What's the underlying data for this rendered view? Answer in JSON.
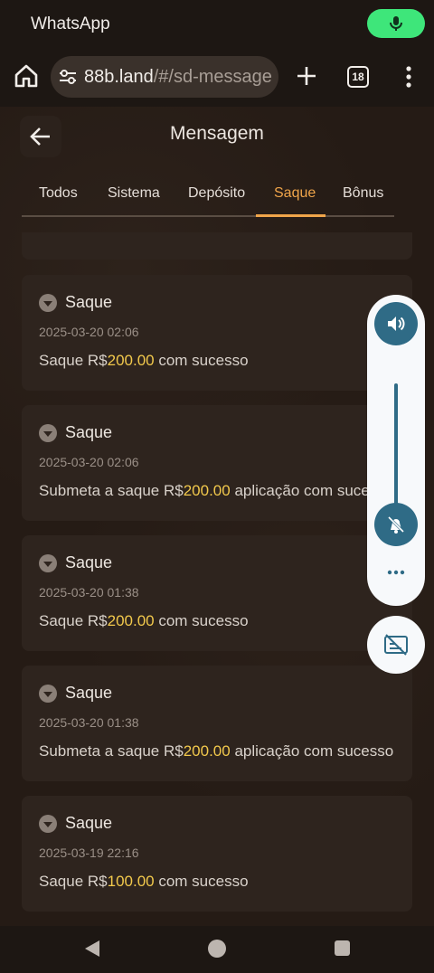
{
  "status_bar": {
    "app_name": "WhatsApp",
    "mic_icon": "mic-icon",
    "mic_color": "#3ee67a"
  },
  "browser": {
    "url_host": "88b.land",
    "url_path": "/#/sd-message",
    "tab_count": "18"
  },
  "page": {
    "title": "Mensagem",
    "accent": "#f0a54a",
    "tabs": [
      {
        "label": "Todos",
        "active": false
      },
      {
        "label": "Sistema",
        "active": false
      },
      {
        "label": "Depósito",
        "active": false
      },
      {
        "label": "Saque",
        "active": true
      },
      {
        "label": "Bônus",
        "active": false
      }
    ]
  },
  "messages": [
    {
      "title": "Saque",
      "date": "2025-03-20 02:06",
      "prefix": "Saque R$",
      "amount": "200.00",
      "suffix": " com sucesso"
    },
    {
      "title": "Saque",
      "date": "2025-03-20 02:06",
      "prefix": "Submeta a saque R$",
      "amount": "200.00",
      "suffix": " aplicação com sucesso"
    },
    {
      "title": "Saque",
      "date": "2025-03-20 01:38",
      "prefix": "Saque R$",
      "amount": "200.00",
      "suffix": " com sucesso"
    },
    {
      "title": "Saque",
      "date": "2025-03-20 01:38",
      "prefix": "Submeta a saque R$",
      "amount": "200.00",
      "suffix": " aplicação com sucesso"
    },
    {
      "title": "Saque",
      "date": "2025-03-19 22:16",
      "prefix": "Saque R$",
      "amount": "100.00",
      "suffix": " com sucesso"
    }
  ],
  "volume_panel": {
    "icons": [
      "volume-icon",
      "ring-muted-icon",
      "more-icon",
      "live-caption-icon"
    ],
    "level": 0.05
  }
}
